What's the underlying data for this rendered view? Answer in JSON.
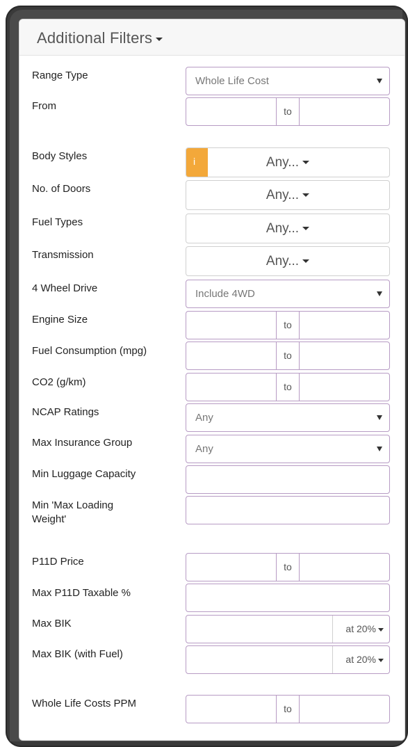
{
  "panel": {
    "title": "Additional Filters"
  },
  "filters": {
    "range_type": {
      "label": "Range Type",
      "value": "Whole Life Cost"
    },
    "from": {
      "label": "From",
      "to": "to"
    },
    "body_styles": {
      "label": "Body Styles",
      "info": "i",
      "value": "Any..."
    },
    "doors": {
      "label": "No. of Doors",
      "value": "Any..."
    },
    "fuel_types": {
      "label": "Fuel Types",
      "value": "Any..."
    },
    "transmission": {
      "label": "Transmission",
      "value": "Any..."
    },
    "four_wd": {
      "label": "4 Wheel Drive",
      "value": "Include 4WD"
    },
    "engine_size": {
      "label": "Engine Size",
      "to": "to"
    },
    "fuel_consumption": {
      "label": "Fuel Consumption (mpg)",
      "to": "to"
    },
    "co2": {
      "label": "CO2 (g/km)",
      "to": "to"
    },
    "ncap": {
      "label": "NCAP Ratings",
      "value": "Any"
    },
    "insurance": {
      "label": "Max Insurance Group",
      "value": "Any"
    },
    "luggage": {
      "label": "Min Luggage Capacity"
    },
    "loading_weight": {
      "label_line1": "Min 'Max Loading",
      "label_line2": "Weight'"
    },
    "p11d_price": {
      "label": "P11D Price",
      "to": "to"
    },
    "p11d_taxable": {
      "label": "Max P11D Taxable %"
    },
    "max_bik": {
      "label": "Max BIK",
      "rate": "at 20%"
    },
    "max_bik_fuel": {
      "label": "Max BIK (with Fuel)",
      "rate": "at 20%"
    },
    "wlc_ppm": {
      "label": "Whole Life Costs PPM",
      "to": "to"
    }
  },
  "colors": {
    "input_border": "#b79bc4",
    "info_badge": "#f3a83a",
    "frame": "#3a3a3a"
  }
}
